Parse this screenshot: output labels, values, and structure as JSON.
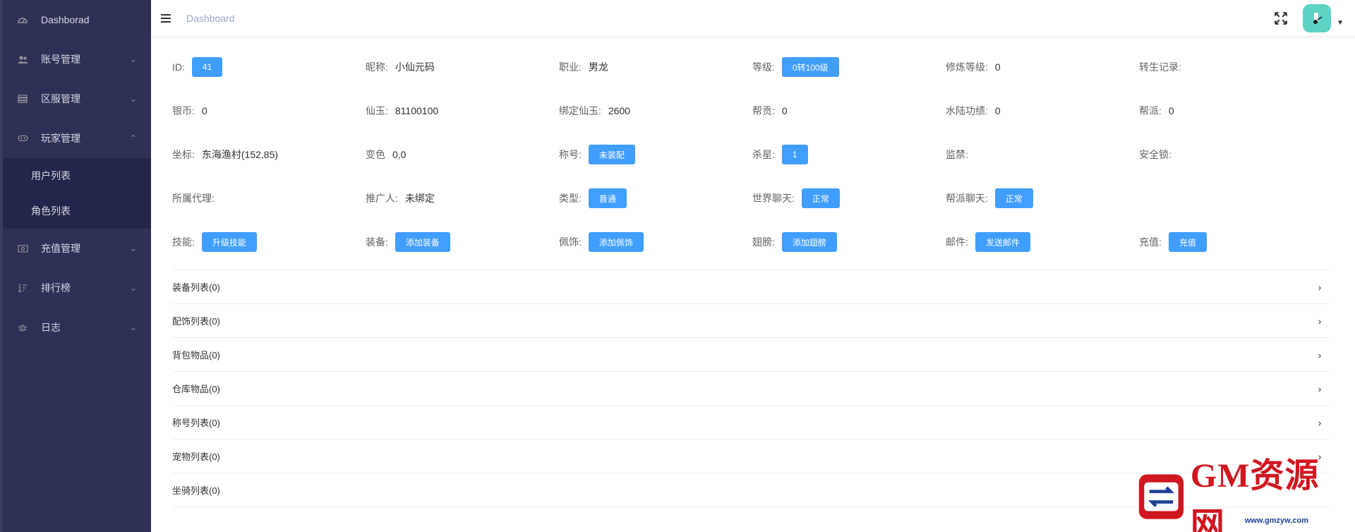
{
  "sidebar": {
    "items": [
      {
        "label": "Dashborad",
        "icon": "dashboard-icon",
        "has_children": false
      },
      {
        "label": "账号管理",
        "icon": "users-icon",
        "has_children": true,
        "chevron": "down"
      },
      {
        "label": "区服管理",
        "icon": "server-icon",
        "has_children": true,
        "chevron": "down"
      },
      {
        "label": "玩家管理",
        "icon": "gamepad-icon",
        "has_children": true,
        "chevron": "up",
        "expanded": true,
        "children": [
          {
            "label": "用户列表"
          },
          {
            "label": "角色列表"
          }
        ]
      },
      {
        "label": "充值管理",
        "icon": "money-icon",
        "has_children": true,
        "chevron": "down"
      },
      {
        "label": "排行榜",
        "icon": "sort-icon",
        "has_children": true,
        "chevron": "down"
      },
      {
        "label": "日志",
        "icon": "bug-icon",
        "has_children": true,
        "chevron": "down"
      }
    ]
  },
  "navbar": {
    "breadcrumb": "Dashboard"
  },
  "info": {
    "id": {
      "label": "ID:",
      "value": "41"
    },
    "nickname": {
      "label": "昵称:",
      "value": "小仙元码"
    },
    "profession": {
      "label": "职业:",
      "value": "男龙"
    },
    "level": {
      "label": "等级:",
      "value": "0转100级"
    },
    "cultivation": {
      "label": "修炼等级:",
      "value": "0"
    },
    "rebirth": {
      "label": "转生记录:",
      "value": ""
    },
    "silver": {
      "label": "银币:",
      "value": "0"
    },
    "jade": {
      "label": "仙玉:",
      "value": "81100100"
    },
    "bound_jade": {
      "label": "绑定仙玉:",
      "value": "2600"
    },
    "guild_contrib": {
      "label": "帮贡:",
      "value": "0"
    },
    "water_land": {
      "label": "水陆功绩:",
      "value": "0"
    },
    "guild": {
      "label": "帮派:",
      "value": "0"
    },
    "coords": {
      "label": "坐标:",
      "value": "东海渔村(152,85)"
    },
    "transform": {
      "label": "变色",
      "value": "0,0"
    },
    "title": {
      "label": "称号:",
      "value": "未装配"
    },
    "kill_star": {
      "label": "杀星:",
      "value": "1"
    },
    "ban": {
      "label": "监禁:",
      "value": ""
    },
    "safe_lock": {
      "label": "安全锁:",
      "value": ""
    },
    "agent": {
      "label": "所属代理:",
      "value": ""
    },
    "referrer": {
      "label": "推广人:",
      "value": "未绑定"
    },
    "type": {
      "label": "类型:",
      "value": "普通"
    },
    "world_chat": {
      "label": "世界聊天:",
      "value": "正常"
    },
    "guild_chat": {
      "label": "帮派聊天:",
      "value": "正常"
    },
    "skill": {
      "label": "技能:",
      "button": "升级技能"
    },
    "equip": {
      "label": "装备:",
      "button": "添加装备"
    },
    "accessory": {
      "label": "佩饰:",
      "button": "添加佩饰"
    },
    "wings": {
      "label": "翅膀:",
      "button": "添加翅膀"
    },
    "mail": {
      "label": "邮件:",
      "button": "发送邮件"
    },
    "recharge": {
      "label": "充值:",
      "button": "充值"
    }
  },
  "lists": [
    "装备列表(0)",
    "配饰列表(0)",
    "背包物品(0)",
    "仓库物品(0)",
    "称号列表(0)",
    "宠物列表(0)",
    "坐骑列表(0)"
  ],
  "watermark": {
    "text": "GM资源网",
    "url": "www.gmzyw.com"
  },
  "colors": {
    "sidebar_bg": "#2f3055",
    "primary": "#409eff",
    "avatar": "#5dd3c6",
    "watermark_red": "#d0161f"
  }
}
